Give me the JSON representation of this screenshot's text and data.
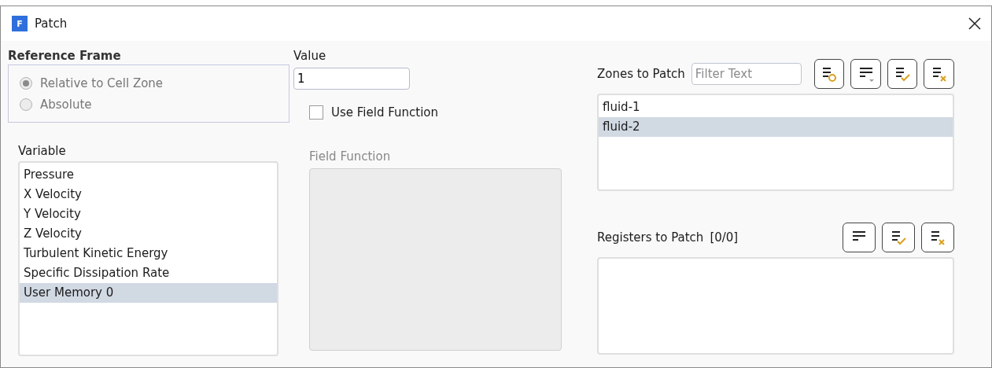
{
  "window": {
    "title": "Patch",
    "app_letter": "F"
  },
  "reference_frame": {
    "label": "Reference Frame",
    "disabled": true,
    "options": [
      {
        "label": "Relative to Cell Zone",
        "selected": true
      },
      {
        "label": "Absolute",
        "selected": false
      }
    ]
  },
  "value": {
    "label": "Value",
    "value": "1"
  },
  "use_field_function": {
    "label": "Use Field Function",
    "checked": false
  },
  "variable": {
    "label": "Variable",
    "items": [
      {
        "label": "Pressure",
        "selected": false
      },
      {
        "label": "X Velocity",
        "selected": false
      },
      {
        "label": "Y Velocity",
        "selected": false
      },
      {
        "label": "Z Velocity",
        "selected": false
      },
      {
        "label": "Turbulent Kinetic Energy",
        "selected": false
      },
      {
        "label": "Specific Dissipation Rate",
        "selected": false
      },
      {
        "label": "User Memory 0",
        "selected": true
      }
    ]
  },
  "field_function": {
    "label": "Field Function",
    "disabled": true
  },
  "zones": {
    "label": "Zones to Patch",
    "filter_placeholder": "Filter Text",
    "buttons": [
      {
        "kind": "match"
      },
      {
        "kind": "sort"
      },
      {
        "kind": "select-all"
      },
      {
        "kind": "deselect-all"
      }
    ],
    "items": [
      {
        "label": "fluid-1",
        "selected": false
      },
      {
        "label": "fluid-2",
        "selected": true
      }
    ]
  },
  "registers": {
    "label": "Registers to Patch",
    "count": "[0/0]",
    "buttons": [
      {
        "kind": "list"
      },
      {
        "kind": "select-all"
      },
      {
        "kind": "deselect-all"
      }
    ]
  }
}
